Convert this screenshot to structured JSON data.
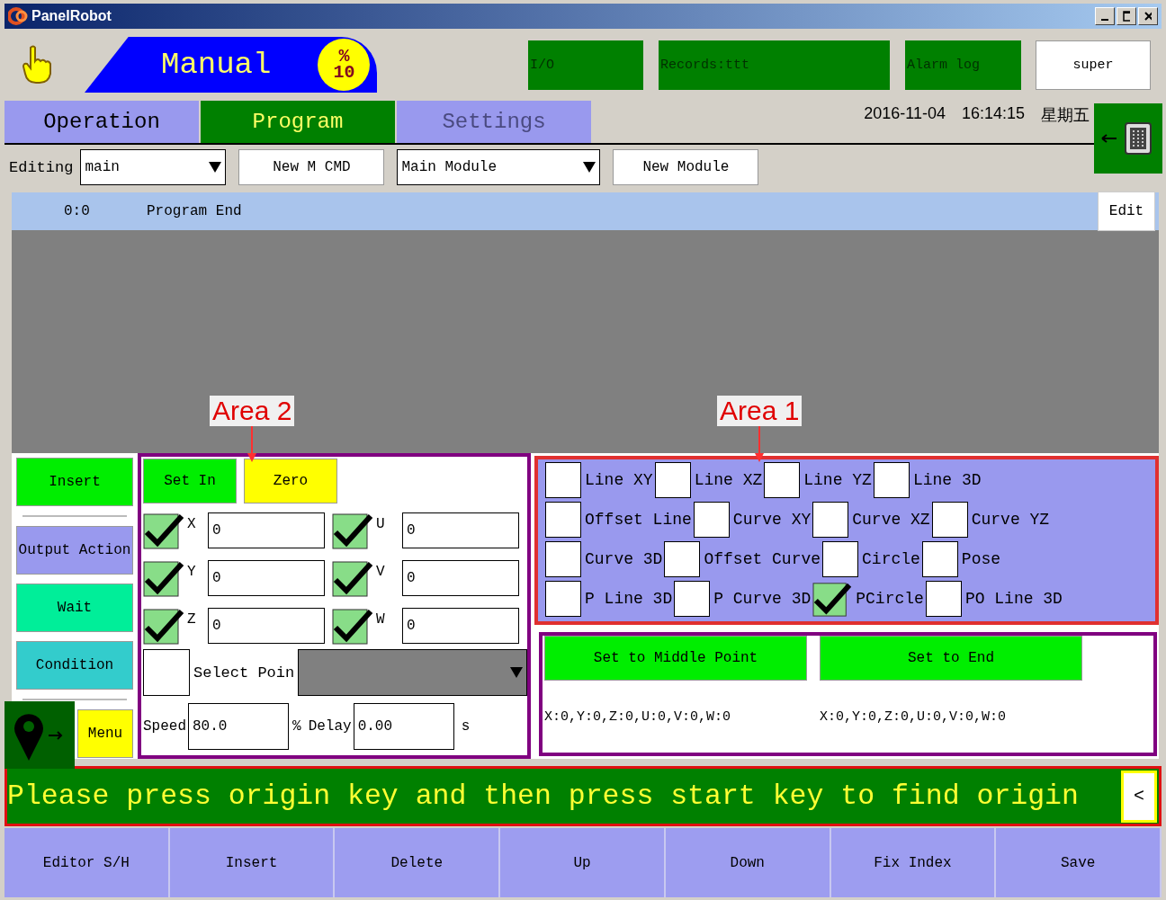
{
  "window": {
    "title": "PanelRobot"
  },
  "header": {
    "mode": "Manual",
    "speed": {
      "symbol": "%",
      "value": "10"
    },
    "buttons": [
      {
        "label": "I/O"
      },
      {
        "label": "Records:ttt"
      },
      {
        "label": "Alarm log"
      }
    ],
    "user": "super"
  },
  "tabs": [
    {
      "label": "Operation",
      "selected": false,
      "disabled": false
    },
    {
      "label": "Program",
      "selected": true,
      "disabled": false
    },
    {
      "label": "Settings",
      "selected": false,
      "disabled": true
    }
  ],
  "datetime": {
    "date": "2016-11-04",
    "time": "16:14:15",
    "weekday": "星期五"
  },
  "editing": {
    "label": "Editing",
    "program": "main",
    "new_cmd": "New M CMD",
    "module": "Main Module",
    "new_module": "New Module"
  },
  "program_list": {
    "rows": [
      {
        "line": "0:0",
        "text": "Program End",
        "selected": true
      }
    ],
    "edit": "Edit"
  },
  "annotations": [
    {
      "label": "Area 2"
    },
    {
      "label": "Area 1"
    }
  ],
  "command_buttons": [
    {
      "label": "Insert",
      "color": "#00ee00"
    },
    {
      "label": "Output Action",
      "color": "#9999ee"
    },
    {
      "label": "Wait",
      "color": "#00ee99"
    },
    {
      "label": "Condition",
      "color": "#33cccc"
    }
  ],
  "menu": "Menu",
  "area2": {
    "set_in": "Set In",
    "zero": "Zero",
    "axes": [
      {
        "name": "X",
        "checked": true,
        "value": "0"
      },
      {
        "name": "U",
        "checked": true,
        "value": "0"
      },
      {
        "name": "Y",
        "checked": true,
        "value": "0"
      },
      {
        "name": "V",
        "checked": true,
        "value": "0"
      },
      {
        "name": "Z",
        "checked": true,
        "value": "0"
      },
      {
        "name": "W",
        "checked": true,
        "value": "0"
      }
    ],
    "select_point": {
      "checked": false,
      "label": "Select Poin"
    },
    "speed": {
      "label": "Speed",
      "value": "80.0",
      "unit": "%"
    },
    "delay": {
      "label": "Delay",
      "value": "0.00",
      "unit": "s"
    }
  },
  "area1": {
    "motions": [
      {
        "label": "Line XY",
        "checked": false
      },
      {
        "label": "Line XZ",
        "checked": false
      },
      {
        "label": "Line YZ",
        "checked": false
      },
      {
        "label": "Line 3D",
        "checked": false
      },
      {
        "label": "Offset Line",
        "checked": false
      },
      {
        "label": "Curve XY",
        "checked": false
      },
      {
        "label": "Curve XZ",
        "checked": false
      },
      {
        "label": "Curve YZ",
        "checked": false
      },
      {
        "label": "Curve 3D",
        "checked": false
      },
      {
        "label": "Offset Curve",
        "checked": false
      },
      {
        "label": "Circle",
        "checked": false
      },
      {
        "label": "Pose",
        "checked": false
      },
      {
        "label": "P Line 3D",
        "checked": false
      },
      {
        "label": "P Curve 3D",
        "checked": false
      },
      {
        "label": "PCircle",
        "checked": true
      },
      {
        "label": "PO Line 3D",
        "checked": false
      }
    ]
  },
  "points": {
    "buttons": [
      "Set to Middle Point",
      "Set to End"
    ],
    "readings": [
      "X:0,Y:0,Z:0,U:0,V:0,W:0",
      "X:0,Y:0,Z:0,U:0,V:0,W:0"
    ]
  },
  "message": {
    "text": "Please press origin key and then press start key to find origin",
    "toggle": "<"
  },
  "toolbar": [
    "Editor S/H",
    "Insert",
    "Delete",
    "Up",
    "Down",
    "Fix Index",
    "Save"
  ]
}
